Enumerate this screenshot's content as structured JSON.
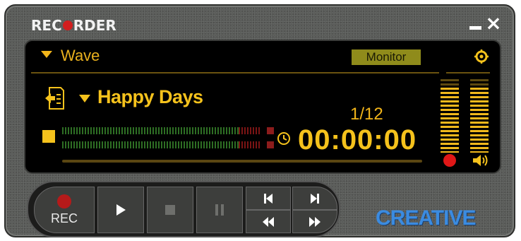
{
  "window": {
    "title_left": "REC",
    "title_right": "RDER",
    "minimize_icon": "minimize-icon",
    "close_label": "×"
  },
  "display": {
    "source_label": "Wave",
    "monitor_label": "Monitor",
    "track_title": "Happy Days",
    "track_counter": "1/12",
    "time": "00:00:00",
    "meter_level": 0.9,
    "vu_left_level": 0.9,
    "vu_right_level": 0.9
  },
  "transport": {
    "rec_label": "REC"
  },
  "brand": {
    "logo_text": "CREATIVE"
  },
  "colors": {
    "display_text": "#f5c21c",
    "record_red": "#e01717",
    "brand_blue": "#3b8be0"
  }
}
